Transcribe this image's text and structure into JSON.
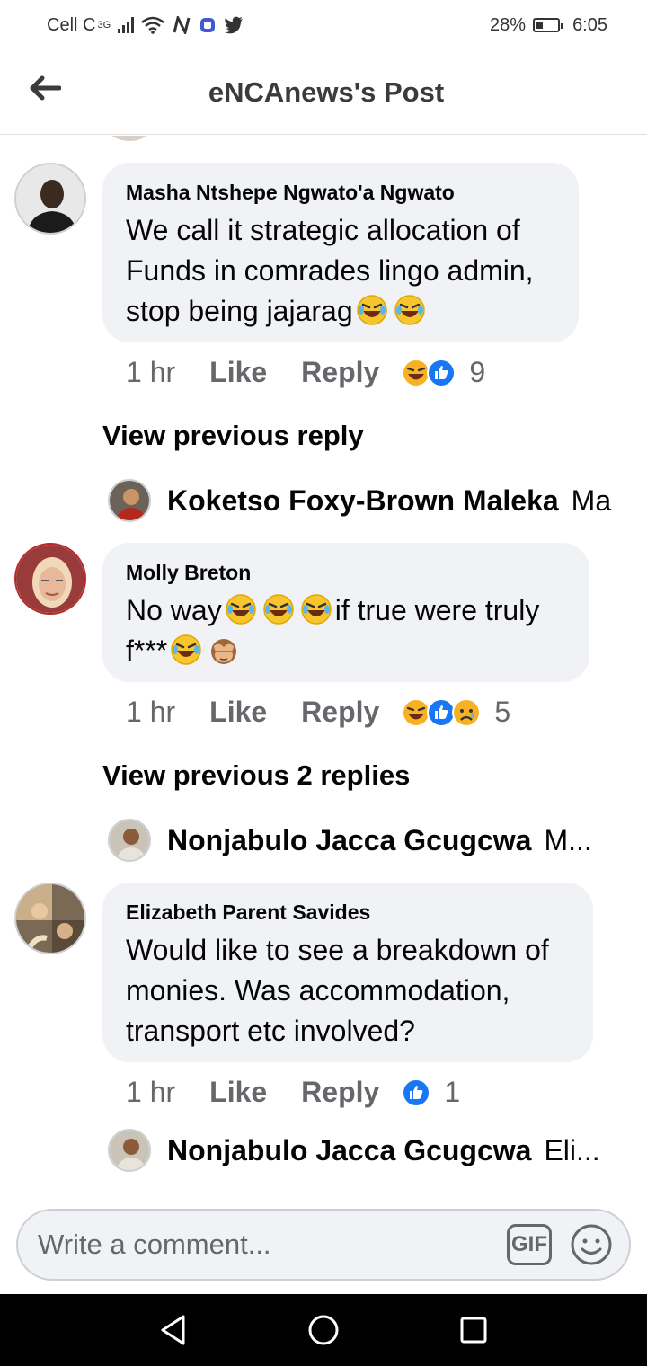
{
  "status_bar": {
    "carrier": "Cell C",
    "network_sup": "3G",
    "battery": "28%",
    "time": "6:05"
  },
  "header": {
    "title": "eNCAnews's Post"
  },
  "comments": [
    {
      "author": "Masha Ntshepe Ngwato'a Ngwato",
      "text_line1": "We call it strategic allocation of",
      "text_line2": "Funds in comrades lingo admin,",
      "text_line3": "stop being jajarag",
      "time": "1 hr",
      "like": "Like",
      "reply": "Reply",
      "reaction_count": "9"
    },
    {
      "author": "Molly Breton",
      "text_part1": "No way",
      "text_part2": "if true were truly",
      "text_line2": "f***",
      "time": "1 hr",
      "like": "Like",
      "reply": "Reply",
      "reaction_count": "5"
    },
    {
      "author": "Elizabeth Parent Savides",
      "text_line1": "Would like to see a breakdown of",
      "text_line2": "monies. Was accommodation,",
      "text_line3": "transport etc involved?",
      "time": "1 hr",
      "like": "Like",
      "reply": "Reply",
      "reaction_count": "1"
    }
  ],
  "view_previous": [
    "View previous reply",
    "View previous 2 replies"
  ],
  "replies": [
    {
      "name": "Koketso Foxy-Brown Maleka",
      "snippet": "Ma"
    },
    {
      "name": "Nonjabulo Jacca Gcugcwa",
      "snippet": "M..."
    },
    {
      "name": "Nonjabulo Jacca Gcugcwa",
      "snippet": "Eli..."
    }
  ],
  "composer": {
    "placeholder": "Write a comment...",
    "gif_label": "GIF"
  },
  "colors": {
    "bubble": "#f0f2f5",
    "meta_gray": "#65676b",
    "like_blue": "#1877f2",
    "haha_yellow": "#f7b125"
  },
  "icons": [
    "back-arrow-icon",
    "laughing-emoji-icon",
    "see-no-evil-monkey-icon",
    "haha-reaction-icon",
    "like-reaction-icon",
    "sad-reaction-icon",
    "smiley-icon",
    "gif-icon",
    "nav-back-icon",
    "nav-home-icon",
    "nav-recents-icon"
  ]
}
